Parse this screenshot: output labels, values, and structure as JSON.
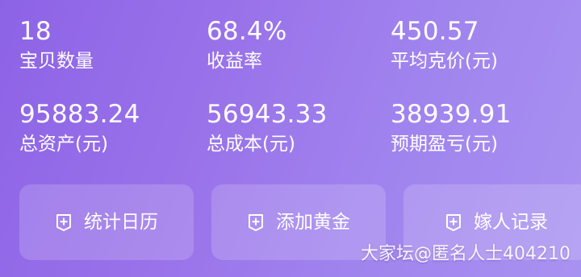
{
  "stats": [
    {
      "value": "18",
      "label": "宝贝数量"
    },
    {
      "value": "68.4%",
      "label": "收益率"
    },
    {
      "value": "450.57",
      "label": "平均克价(元)"
    },
    {
      "value": "95883.24",
      "label": "总资产(元)"
    },
    {
      "value": "56943.33",
      "label": "总成本(元)"
    },
    {
      "value": "38939.91",
      "label": "预期盈亏(元)"
    }
  ],
  "actions": [
    {
      "label": "统计日历",
      "icon": "add-badge-icon"
    },
    {
      "label": "添加黄金",
      "icon": "add-badge-icon"
    },
    {
      "label": "嫁人记录",
      "icon": "add-badge-icon"
    }
  ],
  "watermark": "大家坛@匿名人士404210",
  "colors": {
    "background_start": "#8d63e6",
    "background_end": "#a892f1",
    "text": "#ffffff"
  }
}
